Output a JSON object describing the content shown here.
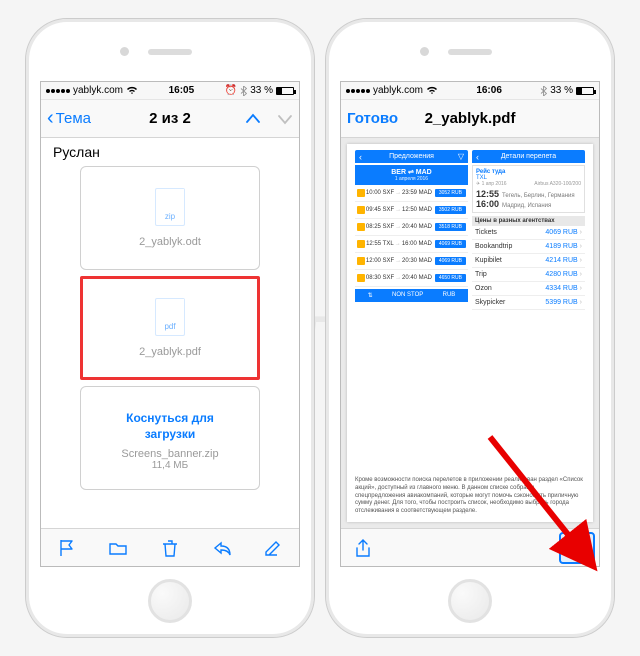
{
  "watermark": "Яблык",
  "left": {
    "status": {
      "carrier": "yablyk.com",
      "time": "16:05",
      "bt": "⚡",
      "battery_pct": "33 %",
      "battery_fill": 33
    },
    "nav": {
      "back_label": "Тема",
      "title": "2 из 2"
    },
    "sender": "Руслан",
    "attachments": [
      {
        "ext": "zip",
        "name": "2_yablyk.odt"
      },
      {
        "ext": "pdf",
        "name": "2_yablyk.pdf"
      },
      {
        "touch_line1": "Коснуться для",
        "touch_line2": "загрузки",
        "name": "Screens_banner.zip",
        "size": "11,4 МБ"
      }
    ]
  },
  "right": {
    "status": {
      "carrier": "yablyk.com",
      "time": "16:06",
      "battery_pct": "33 %",
      "battery_fill": 33
    },
    "nav": {
      "done_label": "Готово",
      "title": "2_yablyk.pdf"
    },
    "pdf": {
      "tab_left": "Предложения",
      "tab_right": "Детали перелета",
      "route": "BER ⇌ MAD",
      "route_date": "1 апреля 2016",
      "flights": [
        {
          "dep": "10:00 SXF",
          "arr": "23:59 MAD",
          "price": "3052 RUB"
        },
        {
          "dep": "09:45 SXF",
          "arr": "12:50 MAD",
          "price": "3502 RUB"
        },
        {
          "dep": "08:25 SXF",
          "arr": "20:40 MAD",
          "price": "3518 RUB"
        },
        {
          "dep": "12:55 TXL",
          "arr": "16:00 MAD",
          "price": "4069 RUB"
        },
        {
          "dep": "12:00 SXF",
          "arr": "20:30 MAD",
          "price": "4069 RUB"
        },
        {
          "dep": "08:30 SXF",
          "arr": "20:40 MAD",
          "price": "4650 RUB"
        }
      ],
      "bottom_nonstop": "NON STOP",
      "bottom_rub": "RUB",
      "detail": {
        "title": "Рейс туда",
        "airport": "TXL",
        "date_tiny": "1 апр 2016",
        "flight_tiny": "Airbus A320-100/200",
        "dep_time": "12:55",
        "dep_city": "Тегель, Берлин, Германия",
        "arr_time": "16:00",
        "arr_city": "Мадрид, Испания"
      },
      "agency_head": "Цены в разных агентствах",
      "agencies": [
        {
          "name": "Tickets",
          "price": "4069 RUB"
        },
        {
          "name": "Bookandtrip",
          "price": "4189 RUB"
        },
        {
          "name": "Kupibilet",
          "price": "4214 RUB"
        },
        {
          "name": "Trip",
          "price": "4280 RUB"
        },
        {
          "name": "Ozon",
          "price": "4334 RUB"
        },
        {
          "name": "Skypicker",
          "price": "5399 RUB"
        }
      ],
      "paragraph": "Кроме возможности поиска перелетов в приложении реализован раздел «Список акций», доступный из главного меню. В данном списке собраны спецпредложения авиакомпаний, которые могут помочь сэкономить приличную сумму денег. Для того, чтобы построить список, необходимо выбрать города отслеживания в соответствующем разделе."
    }
  }
}
